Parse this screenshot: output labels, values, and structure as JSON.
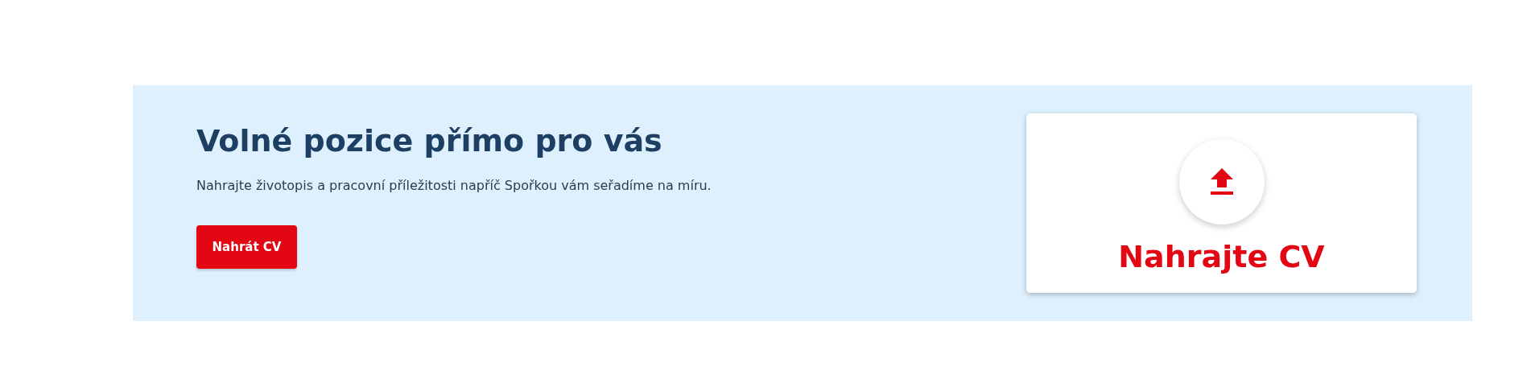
{
  "banner": {
    "title": "Volné pozice přímo pro vás",
    "description": "Nahrajte životopis a pracovní příležitosti napříč Spořkou vám seřadíme na míru.",
    "button": "Nahrát CV"
  },
  "upload_card": {
    "label": "Nahrajte CV"
  }
}
